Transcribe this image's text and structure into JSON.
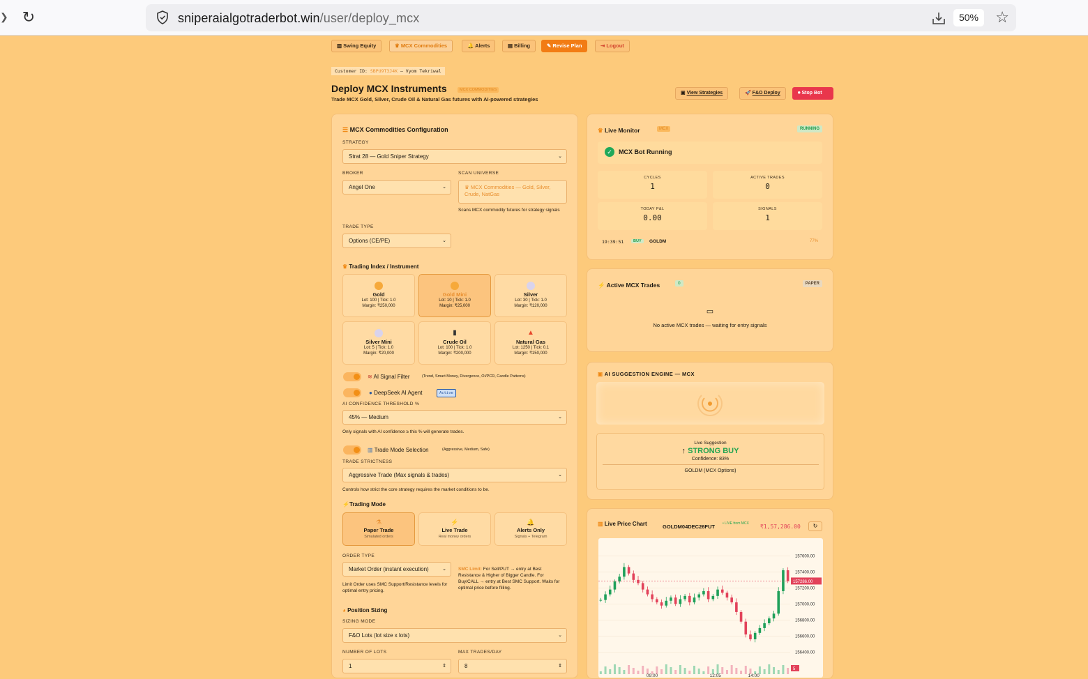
{
  "browser": {
    "url_domain": "sniperaialgotraderbot.win",
    "url_path": "/user/deploy_mcx",
    "zoom": "50%"
  },
  "nav": {
    "items": [
      {
        "label": "Swing Equity",
        "icon": "chart-icon"
      },
      {
        "label": "MCX Commodities",
        "icon": "crown-icon"
      },
      {
        "label": "Alerts",
        "icon": "bell-icon"
      },
      {
        "label": "Billing",
        "icon": "receipt-icon"
      },
      {
        "label": "Revise Plan",
        "icon": "edit-icon"
      },
      {
        "label": "Logout",
        "icon": "logout-icon"
      }
    ]
  },
  "customer": {
    "prefix": "Customer ID:",
    "id": "SBPU9T3J4K",
    "name": "— Vyom Tekriwal"
  },
  "header": {
    "title": "Deploy MCX Instruments",
    "badge": "MCX COMMODITIES",
    "subtitle": "Trade MCX Gold, Silver, Crude Oil & Natural Gas futures with AI-powered strategies",
    "view_strategies": "View Strategies",
    "fo_deploy": "F&O Deploy",
    "stop_bot": "Stop Bot"
  },
  "config": {
    "title": "MCX Commodities Configuration",
    "strategy_label": "STRATEGY",
    "strategy_value": "Strat 28 — Gold Sniper Strategy",
    "broker_label": "BROKER",
    "broker_value": "Angel One",
    "scan_label": "SCAN UNIVERSE",
    "scan_value": "MCX Commodities — Gold, Silver, Crude, NatGas",
    "scan_note": "Scans MCX commodity futures for strategy signals",
    "trade_type_label": "TRADE TYPE",
    "trade_type_value": "Options (CE/PE)",
    "instrument_title": "Trading Index / Instrument",
    "instruments": [
      {
        "name": "Gold",
        "lot": "Lot: 100 | Tick: 1.0",
        "margin": "Margin: ₹250,000",
        "icon": "●"
      },
      {
        "name": "Gold Mini",
        "lot": "Lot: 10 | Tick: 1.0",
        "margin": "Margin: ₹25,000",
        "icon": "●"
      },
      {
        "name": "Silver",
        "lot": "Lot: 30 | Tick: 1.0",
        "margin": "Margin: ₹120,000",
        "icon": "●"
      },
      {
        "name": "Silver Mini",
        "lot": "Lot: 5 | Tick: 1.0",
        "margin": "Margin: ₹20,000",
        "icon": "●"
      },
      {
        "name": "Crude Oil",
        "lot": "Lot: 100 | Tick: 1.0",
        "margin": "Margin: ₹200,000",
        "icon": "▮"
      },
      {
        "name": "Natural Gas",
        "lot": "Lot: 1250 | Tick: 0.1",
        "margin": "Margin: ₹150,000",
        "icon": "▲"
      }
    ],
    "ai_filter_label": "AI Signal Filter",
    "ai_filter_note": "(Trend, Smart Money, Divergence, OI/PCR, Candle Patterns)",
    "deepseek_label": "DeepSeek AI Agent",
    "deepseek_badge": "Active",
    "confidence_label": "AI CONFIDENCE THRESHOLD %",
    "confidence_value": "45% — Medium",
    "confidence_note": "Only signals with AI confidence ≥ this % will generate trades.",
    "trade_mode_sel_label": "Trade Mode Selection",
    "trade_mode_sel_note": "(Aggressive, Medium, Safe)",
    "strictness_label": "TRADE STRICTNESS",
    "strictness_value": "Aggressive Trade (Max signals & trades)",
    "strictness_note": "Controls how strict the core strategy requires the market conditions to be.",
    "trading_mode_title": "Trading Mode",
    "modes": [
      {
        "title": "Paper Trade",
        "sub": "Simulated orders",
        "icon": "⚗"
      },
      {
        "title": "Live Trade",
        "sub": "Real money orders",
        "icon": "⚡"
      },
      {
        "title": "Alerts Only",
        "sub": "Signals + Telegram",
        "icon": "🔔"
      }
    ],
    "order_type_label": "ORDER TYPE",
    "order_type_value": "Market Order (instant execution)",
    "order_note": "Limit Order uses SMC Support/Resistance levels for optimal entry pricing.",
    "smc_head": "SMC Limit:",
    "smc_text": "For Sell/PUT → entry at Best Resistance & Higher of Bigger Candle. For Buy/CALL → entry at Best SMC Support. Waits for optimal price before filling.",
    "sizing_title": "Position Sizing",
    "sizing_mode_label": "SIZING MODE",
    "sizing_mode_value": "F&O Lots (lot size x lots)",
    "lots_label": "NUMBER OF LOTS",
    "lots_value": "1",
    "max_trades_label": "MAX TRADES/DAY",
    "max_trades_value": "8"
  },
  "monitor": {
    "title": "Live Monitor",
    "badge": "MCX",
    "status": "RUNNING",
    "running_text": "MCX Bot Running",
    "stats": [
      {
        "label": "CYCLES",
        "value": "1"
      },
      {
        "label": "ACTIVE TRADES",
        "value": "0"
      },
      {
        "label": "TODAY P&L",
        "value": "0.00"
      },
      {
        "label": "SIGNALS",
        "value": "1"
      }
    ],
    "log_time": "19:39:51",
    "log_side": "BUY",
    "log_symbol": "GOLDM",
    "log_pct": "77%"
  },
  "trades": {
    "title": "Active MCX Trades",
    "count": "0",
    "mode": "PAPER",
    "empty": "No active MCX trades — waiting for entry signals"
  },
  "ai_engine": {
    "title": "AI SUGGESTION ENGINE — MCX",
    "live_label": "Live Suggestion",
    "signal": "STRONG BUY",
    "confidence": "Confidence: 83%",
    "symbol": "GOLDM (MCX Options)"
  },
  "price_chart": {
    "title": "Live Price Chart",
    "symbol": "GOLDM04DEC26FUT",
    "live_tag": "• LIVE from MCX",
    "price": "₹1,57,286.00",
    "current_label": "157286.00",
    "vol_tag": "5"
  },
  "chart_data": {
    "type": "candlestick",
    "symbol": "GOLDM04DEC26FUT",
    "ylim": [
      156300,
      157750
    ],
    "yticks": [
      "157600.00",
      "157400.00",
      "157200.00",
      "157000.00",
      "156800.00",
      "156600.00",
      "156400.00"
    ],
    "xticks": [
      "09:00",
      "12:05",
      "14:00"
    ],
    "close_series": [
      157050,
      157120,
      157180,
      157280,
      157340,
      157460,
      157380,
      157300,
      157260,
      157180,
      157120,
      157060,
      157020,
      156980,
      157040,
      157080,
      157000,
      157060,
      157100,
      157020,
      157080,
      157120,
      157160,
      157060,
      157100,
      157180,
      157140,
      157080,
      157020,
      156900,
      156780,
      156620,
      156560,
      156640,
      156700,
      156760,
      156820,
      156880,
      157160,
      157420,
      157286
    ],
    "current_price": 157286
  }
}
